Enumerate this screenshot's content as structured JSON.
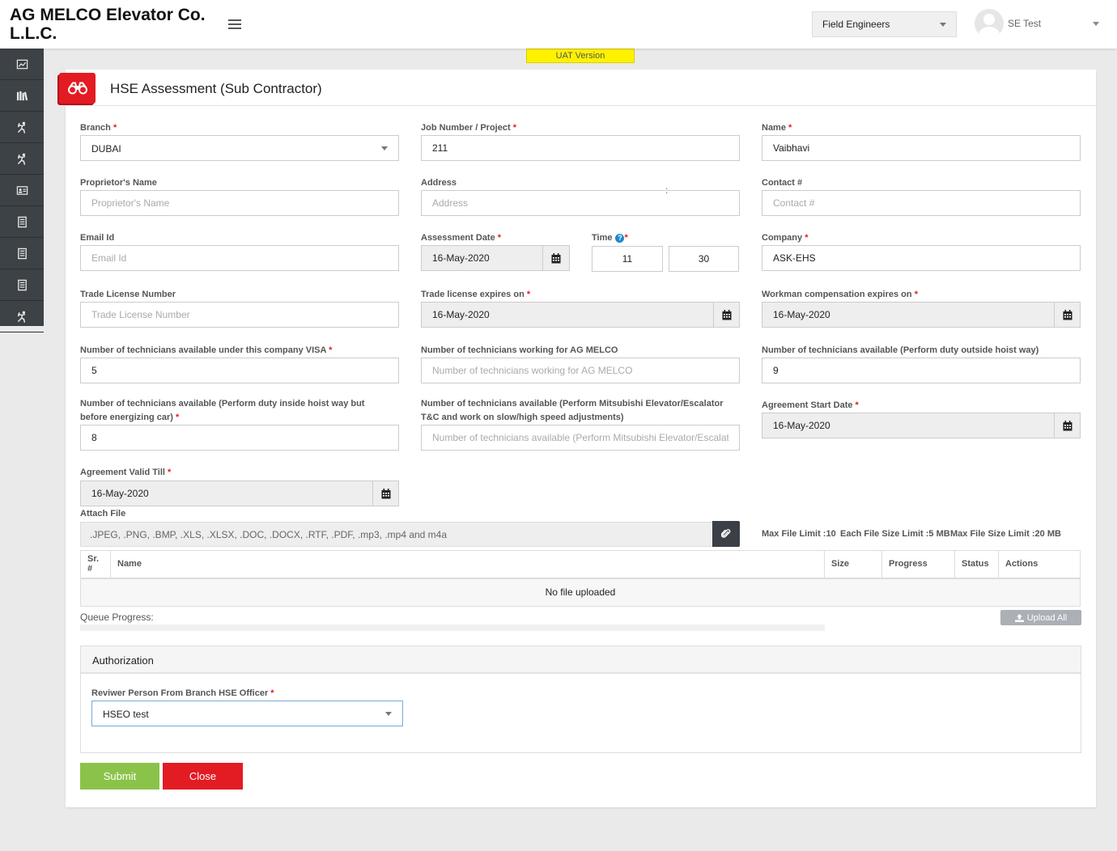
{
  "header": {
    "company_name": "AG MELCO Elevator Co. L.L.C.",
    "role_select": "Field Engineers",
    "user_name": "SE Test",
    "uat_badge": "UAT Version"
  },
  "sidebar": {
    "icons": [
      "chart-icon",
      "library-icon",
      "worker-icon",
      "worker-icon",
      "id-card-icon",
      "document-icon",
      "document-icon",
      "document-icon",
      "worker-icon"
    ]
  },
  "page": {
    "title": "HSE Assessment (Sub Contractor)"
  },
  "form": {
    "branch": {
      "label": "Branch",
      "value": "DUBAI"
    },
    "job_number": {
      "label": "Job Number / Project",
      "value": "211"
    },
    "name": {
      "label": "Name",
      "value": "Vaibhavi"
    },
    "proprietor_name": {
      "label": "Proprietor's Name",
      "placeholder": "Proprietor's Name",
      "value": ""
    },
    "address": {
      "label": "Address",
      "placeholder": "Address",
      "value": ""
    },
    "contact": {
      "label": "Contact #",
      "placeholder": "Contact #",
      "value": ""
    },
    "email": {
      "label": "Email Id",
      "placeholder": "Email Id",
      "value": ""
    },
    "assessment_date": {
      "label": "Assessment Date",
      "value": "16-May-2020"
    },
    "time": {
      "label": "Time",
      "hour": "11",
      "minute": "30"
    },
    "company": {
      "label": "Company",
      "value": "ASK-EHS"
    },
    "trade_license_number": {
      "label": "Trade License Number",
      "placeholder": "Trade License Number",
      "value": ""
    },
    "trade_license_expires": {
      "label": "Trade license expires on",
      "value": "16-May-2020"
    },
    "workman_comp_expires": {
      "label": "Workman compensation expires on",
      "value": "16-May-2020"
    },
    "techs_under_visa": {
      "label": "Number of technicians available under this company VISA",
      "value": "5"
    },
    "techs_for_agmelco": {
      "label": "Number of technicians working for AG MELCO",
      "placeholder": "Number of technicians working for AG MELCO",
      "value": ""
    },
    "techs_outside_hoist": {
      "label": "Number of technicians available (Perform duty outside hoist way)",
      "value": "9"
    },
    "techs_inside_hoist": {
      "label": "Number of technicians available (Perform duty inside hoist way but before energizing car)",
      "value": "8"
    },
    "techs_mitsubishi": {
      "label": "Number of technicians available (Perform Mitsubishi Elevator/Escalator T&C and work on slow/high speed adjustments)",
      "placeholder": "Number of technicians available (Perform Mitsubishi Elevator/Escalator",
      "value": ""
    },
    "agreement_start": {
      "label": "Agreement Start Date",
      "value": "16-May-2020"
    },
    "agreement_valid_till": {
      "label": "Agreement Valid Till",
      "value": "16-May-2020"
    },
    "attach": {
      "label": "Attach File",
      "placeholder": ".JPEG, .PNG, .BMP, .XLS, .XLSX, .DOC, .DOCX, .RTF, .PDF, .mp3, .mp4 and m4a",
      "max_file_limit": "Max File Limit :10",
      "each_file_size": "Each File Size Limit :5 MB",
      "max_file_size": "Max File Size Limit :20 MB"
    }
  },
  "files_table": {
    "columns": [
      "Sr. #",
      "Name",
      "Size",
      "Progress",
      "Status",
      "Actions"
    ],
    "empty_message": "No file uploaded",
    "queue_progress_label": "Queue Progress:",
    "queue_progress": 0,
    "upload_all": "Upload All"
  },
  "authorization": {
    "title": "Authorization",
    "reviewer_label": "Reviwer Person From Branch HSE Officer",
    "reviewer_value": "HSEO test"
  },
  "actions": {
    "submit": "Submit",
    "close": "Close"
  },
  "colors": {
    "brand_red": "#e31b23",
    "submit_green": "#8bc34a",
    "sidebar_dark": "#3d4246",
    "uat_yellow": "#fff200"
  }
}
